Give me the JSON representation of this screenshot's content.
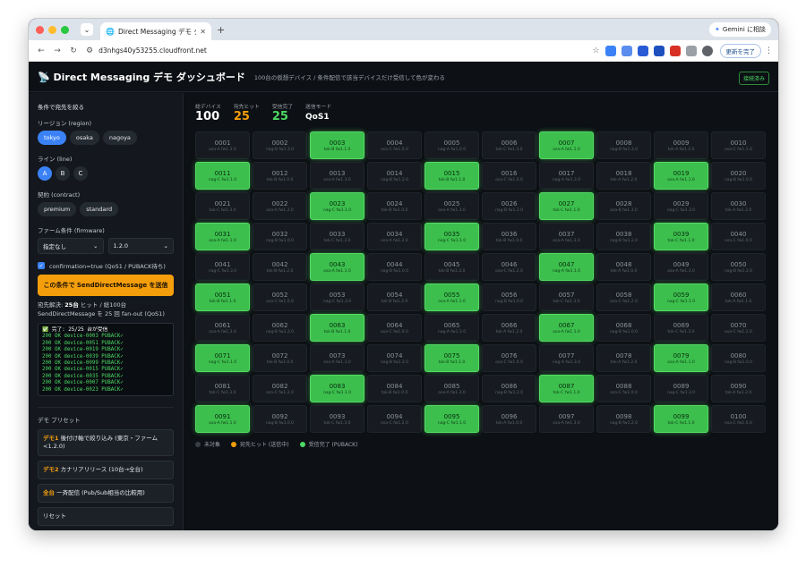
{
  "browser": {
    "tab_title": "Direct Messaging デモ ダッシュボ",
    "url": "d3nhgs40y53255.cloudfront.net",
    "gemini_label": "Gemini に相談",
    "update_label": "更新を完了"
  },
  "header": {
    "title": "📡 Direct Messaging デモ ダッシュボード",
    "subtitle": "100台の仮想デバイス / 条件配信で該当デバイスだけ受信して色が変わる",
    "connection": "接続済み"
  },
  "sidebar": {
    "section_title": "条件で宛先を絞る",
    "region_label": "リージョン (region)",
    "regions": [
      "tokyo",
      "osaka",
      "nagoya"
    ],
    "line_label": "ライン (line)",
    "lines": [
      "A",
      "B",
      "C"
    ],
    "contract_label": "契約 (contract)",
    "contracts": [
      "premium",
      "standard"
    ],
    "firmware_label": "ファーム条件 (firmware)",
    "firmware_op": "指定なし",
    "firmware_version": "1.2.0",
    "confirmation_label": "confirmation=true (QoS1 / PUBACK待ち)",
    "send_button": "この条件で SendDirectMessage を送信",
    "result_prefix": "宛先解決:",
    "result_hits": "25台",
    "result_suffix": "ヒット / 総100台",
    "fanout": "SendDirectMessage を 25 回 fan-out (QoS1)",
    "log_done": "✅ 完了: 25/25 台が受信",
    "log_lines": [
      "200 OK device-0003 PUBACK✓",
      "200 OK device-0051 PUBACK✓",
      "200 OK device-0019 PUBACK✓",
      "200 OK device-0039 PUBACK✓",
      "200 OK device-0099 PUBACK✓",
      "200 OK device-0015 PUBACK✓",
      "200 OK device-0035 PUBACK✓",
      "200 OK device-0007 PUBACK✓",
      "200 OK device-0023 PUBACK✓"
    ],
    "presets_title": "デモ プリセット",
    "presets": [
      {
        "tag": "デモ1",
        "text": "後付け軸で絞り込み (東京・ファーム<1.2.0)"
      },
      {
        "tag": "デモ2",
        "text": "カナリアリリース (10台→全台)"
      },
      {
        "tag": "全台",
        "text": "一斉配信 (Pub/Sub相当の比較用)"
      },
      {
        "tag": "",
        "text": "リセット"
      }
    ]
  },
  "stats": [
    {
      "key": "総デバイス",
      "value": "100",
      "tone": ""
    },
    {
      "key": "宛先ヒット",
      "value": "25",
      "tone": "orange"
    },
    {
      "key": "受信完了",
      "value": "25",
      "tone": "green"
    },
    {
      "key": "送信モード",
      "value": "QoS1",
      "tone": "small"
    }
  ],
  "devices": [
    {
      "id": "0001",
      "meta": "osa-A fw1.3.0",
      "ok": false
    },
    {
      "id": "0002",
      "meta": "nag-B fw1.3.0",
      "ok": false
    },
    {
      "id": "0003",
      "meta": "tok-B fw1.1.0",
      "ok": true
    },
    {
      "id": "0004",
      "meta": "osa-C fw1.0.0",
      "ok": false
    },
    {
      "id": "0005",
      "meta": "nag-A fw1.0.0",
      "ok": false
    },
    {
      "id": "0006",
      "meta": "tok-C fw1.3.0",
      "ok": false
    },
    {
      "id": "0007",
      "meta": "osa-A fw1.1.0",
      "ok": true
    },
    {
      "id": "0008",
      "meta": "nag-B fw1.3.0",
      "ok": false
    },
    {
      "id": "0009",
      "meta": "tok-A fw1.2.0",
      "ok": false
    },
    {
      "id": "0010",
      "meta": "osa-C fw1.1.0",
      "ok": false
    },
    {
      "id": "0011",
      "meta": "nag-C fw1.1.0",
      "ok": true
    },
    {
      "id": "0012",
      "meta": "tok-B fw1.0.0",
      "ok": false
    },
    {
      "id": "0013",
      "meta": "osa-A fw1.3.0",
      "ok": false
    },
    {
      "id": "0014",
      "meta": "nag-B fw1.2.0",
      "ok": false
    },
    {
      "id": "0015",
      "meta": "tok-B fw1.1.0",
      "ok": true
    },
    {
      "id": "0016",
      "meta": "osa-C fw1.0.0",
      "ok": false
    },
    {
      "id": "0017",
      "meta": "nag-A fw1.3.0",
      "ok": false
    },
    {
      "id": "0018",
      "meta": "tok-A fw1.2.0",
      "ok": false
    },
    {
      "id": "0019",
      "meta": "osa-A fw1.1.0",
      "ok": true
    },
    {
      "id": "0020",
      "meta": "nag-B fw1.0.0",
      "ok": false
    },
    {
      "id": "0021",
      "meta": "tok-C fw1.3.0",
      "ok": false
    },
    {
      "id": "0022",
      "meta": "osa-A fw1.2.0",
      "ok": false
    },
    {
      "id": "0023",
      "meta": "nag-C fw1.1.0",
      "ok": true
    },
    {
      "id": "0024",
      "meta": "tok-B fw1.0.0",
      "ok": false
    },
    {
      "id": "0025",
      "meta": "osa-A fw1.3.0",
      "ok": false
    },
    {
      "id": "0026",
      "meta": "nag-B fw1.2.0",
      "ok": false
    },
    {
      "id": "0027",
      "meta": "tok-C fw1.1.0",
      "ok": true
    },
    {
      "id": "0028",
      "meta": "osa-B fw1.3.0",
      "ok": false
    },
    {
      "id": "0029",
      "meta": "nag-C fw1.3.0",
      "ok": false
    },
    {
      "id": "0030",
      "meta": "tok-A fw1.2.0",
      "ok": false
    },
    {
      "id": "0031",
      "meta": "osa-A fw1.1.0",
      "ok": true
    },
    {
      "id": "0032",
      "meta": "nag-B fw1.0.0",
      "ok": false
    },
    {
      "id": "0033",
      "meta": "tok-C fw1.3.0",
      "ok": false
    },
    {
      "id": "0034",
      "meta": "osa-A fw1.2.0",
      "ok": false
    },
    {
      "id": "0035",
      "meta": "nag-C fw1.1.0",
      "ok": true
    },
    {
      "id": "0036",
      "meta": "tok-B fw1.0.0",
      "ok": false
    },
    {
      "id": "0037",
      "meta": "osa-A fw1.3.0",
      "ok": false
    },
    {
      "id": "0038",
      "meta": "nag-B fw1.2.0",
      "ok": false
    },
    {
      "id": "0039",
      "meta": "tok-C fw1.1.0",
      "ok": true
    },
    {
      "id": "0040",
      "meta": "osa-C fw1.0.0",
      "ok": false
    },
    {
      "id": "0041",
      "meta": "nag-C fw1.3.0",
      "ok": false
    },
    {
      "id": "0042",
      "meta": "tok-B fw1.2.0",
      "ok": false
    },
    {
      "id": "0043",
      "meta": "osa-A fw1.1.0",
      "ok": true
    },
    {
      "id": "0044",
      "meta": "nag-B fw1.0.0",
      "ok": false
    },
    {
      "id": "0045",
      "meta": "tok-B fw1.3.0",
      "ok": false
    },
    {
      "id": "0046",
      "meta": "osa-C fw1.2.0",
      "ok": false
    },
    {
      "id": "0047",
      "meta": "nag-A fw1.1.0",
      "ok": true
    },
    {
      "id": "0048",
      "meta": "tok-A fw1.0.0",
      "ok": false
    },
    {
      "id": "0049",
      "meta": "osa-A fw1.3.0",
      "ok": false
    },
    {
      "id": "0050",
      "meta": "nag-B fw1.2.0",
      "ok": false
    },
    {
      "id": "0051",
      "meta": "tok-B fw1.1.0",
      "ok": true
    },
    {
      "id": "0052",
      "meta": "osa-C fw1.0.0",
      "ok": false
    },
    {
      "id": "0053",
      "meta": "nag-C fw1.3.0",
      "ok": false
    },
    {
      "id": "0054",
      "meta": "tok-B fw1.2.0",
      "ok": false
    },
    {
      "id": "0055",
      "meta": "osa-A fw1.1.0",
      "ok": true
    },
    {
      "id": "0056",
      "meta": "nag-B fw1.0.0",
      "ok": false
    },
    {
      "id": "0057",
      "meta": "tok-C fw1.3.0",
      "ok": false
    },
    {
      "id": "0058",
      "meta": "osa-C fw1.2.0",
      "ok": false
    },
    {
      "id": "0059",
      "meta": "nag-C fw1.1.0",
      "ok": true
    },
    {
      "id": "0060",
      "meta": "tok-A fw1.1.0",
      "ok": false
    },
    {
      "id": "0061",
      "meta": "osa-A fw1.3.0",
      "ok": false
    },
    {
      "id": "0062",
      "meta": "nag-B fw1.2.0",
      "ok": false
    },
    {
      "id": "0063",
      "meta": "tok-B fw1.1.0",
      "ok": true
    },
    {
      "id": "0064",
      "meta": "osa-C fw1.0.0",
      "ok": false
    },
    {
      "id": "0065",
      "meta": "nag-A fw1.3.0",
      "ok": false
    },
    {
      "id": "0066",
      "meta": "tok-A fw1.2.0",
      "ok": false
    },
    {
      "id": "0067",
      "meta": "osa-A fw1.1.0",
      "ok": true
    },
    {
      "id": "0068",
      "meta": "nag-B fw1.0.0",
      "ok": false
    },
    {
      "id": "0069",
      "meta": "tok-C fw1.3.0",
      "ok": false
    },
    {
      "id": "0070",
      "meta": "osa-C fw1.2.0",
      "ok": false
    },
    {
      "id": "0071",
      "meta": "nag-C fw1.1.0",
      "ok": true
    },
    {
      "id": "0072",
      "meta": "tok-B fw1.0.0",
      "ok": false
    },
    {
      "id": "0073",
      "meta": "osa-A fw1.3.0",
      "ok": false
    },
    {
      "id": "0074",
      "meta": "nag-B fw1.2.0",
      "ok": false
    },
    {
      "id": "0075",
      "meta": "tok-B fw1.1.0",
      "ok": true
    },
    {
      "id": "0076",
      "meta": "osa-C fw1.0.0",
      "ok": false
    },
    {
      "id": "0077",
      "meta": "nag-A fw1.3.0",
      "ok": false
    },
    {
      "id": "0078",
      "meta": "tok-A fw1.2.0",
      "ok": false
    },
    {
      "id": "0079",
      "meta": "osa-A fw1.1.0",
      "ok": true
    },
    {
      "id": "0080",
      "meta": "nag-B fw1.0.0",
      "ok": false
    },
    {
      "id": "0081",
      "meta": "tok-C fw1.3.0",
      "ok": false
    },
    {
      "id": "0082",
      "meta": "osa-C fw1.2.0",
      "ok": false
    },
    {
      "id": "0083",
      "meta": "nag-C fw1.1.0",
      "ok": true
    },
    {
      "id": "0084",
      "meta": "tok-B fw1.0.0",
      "ok": false
    },
    {
      "id": "0085",
      "meta": "osa-A fw1.3.0",
      "ok": false
    },
    {
      "id": "0086",
      "meta": "nag-B fw1.2.0",
      "ok": false
    },
    {
      "id": "0087",
      "meta": "tok-C fw1.1.0",
      "ok": true
    },
    {
      "id": "0088",
      "meta": "osa-C fw1.0.0",
      "ok": false
    },
    {
      "id": "0089",
      "meta": "nag-C fw1.3.0",
      "ok": false
    },
    {
      "id": "0090",
      "meta": "tok-A fw1.2.0",
      "ok": false
    },
    {
      "id": "0091",
      "meta": "osa-A fw1.1.0",
      "ok": true
    },
    {
      "id": "0092",
      "meta": "nag-B fw1.0.0",
      "ok": false
    },
    {
      "id": "0093",
      "meta": "tok-C fw1.3.0",
      "ok": false
    },
    {
      "id": "0094",
      "meta": "osa-C fw1.2.0",
      "ok": false
    },
    {
      "id": "0095",
      "meta": "nag-C fw1.1.0",
      "ok": true
    },
    {
      "id": "0096",
      "meta": "tok-A fw1.0.0",
      "ok": false
    },
    {
      "id": "0097",
      "meta": "osa-A fw1.3.0",
      "ok": false
    },
    {
      "id": "0098",
      "meta": "nag-B fw1.2.0",
      "ok": false
    },
    {
      "id": "0099",
      "meta": "tok-C fw1.1.0",
      "ok": true
    },
    {
      "id": "0100",
      "meta": "osa-C fw1.0.0",
      "ok": false
    }
  ],
  "legend": [
    {
      "label": "未対象",
      "color": "#3a3f47"
    },
    {
      "label": "宛先ヒット (送信中)",
      "color": "#f59e0b"
    },
    {
      "label": "受信完了 (PUBACK)",
      "color": "#4cd964"
    }
  ]
}
